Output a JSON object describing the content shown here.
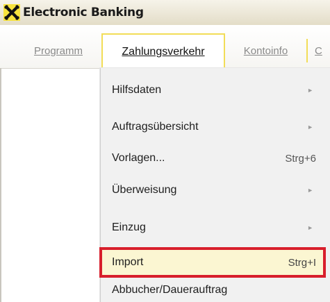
{
  "window": {
    "title": "Electronic Banking",
    "logo_icon": "raiffeisen-cross-icon"
  },
  "menubar": {
    "items": [
      {
        "label": "Programm",
        "state": "dimmed"
      },
      {
        "label": "Zahlungsverkehr",
        "state": "active"
      },
      {
        "label": "Kontoinfo",
        "state": "dimmed"
      },
      {
        "label": "C",
        "state": "dimmed-clipped"
      }
    ]
  },
  "dropdown": {
    "items": [
      {
        "label": "Hilfsdaten",
        "shortcut": "",
        "submenu": true
      },
      {
        "label": "Auftragsübersicht",
        "shortcut": "",
        "submenu": true
      },
      {
        "label": "Vorlagen...",
        "shortcut": "Strg+6",
        "submenu": false
      },
      {
        "label": "Überweisung",
        "shortcut": "",
        "submenu": true
      },
      {
        "label": "Einzug",
        "shortcut": "",
        "submenu": true
      },
      {
        "label": "Import",
        "shortcut": "Strg+I",
        "submenu": false,
        "highlighted": true
      },
      {
        "label": "Abbucher/Dauerauftrag",
        "shortcut": "",
        "submenu": false
      }
    ]
  },
  "colors": {
    "menu_accent": "#f2dd57",
    "highlight_border": "#d81f2c",
    "highlight_background": "#fbf6d2",
    "logo_yellow": "#f7e33d"
  }
}
